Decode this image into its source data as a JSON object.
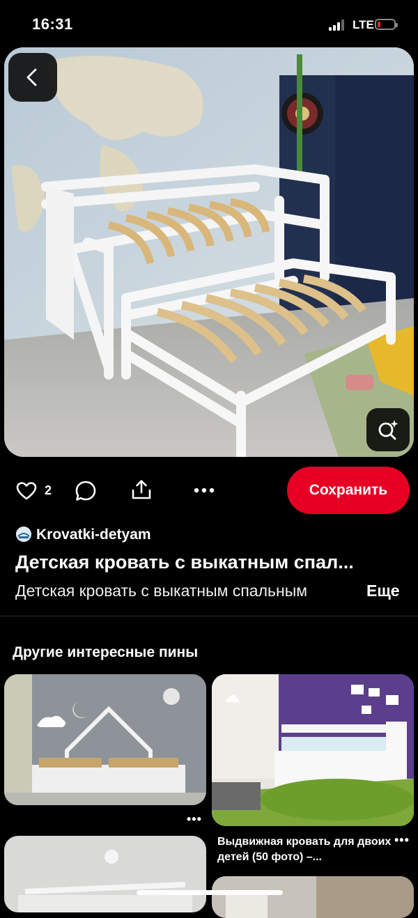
{
  "status_bar": {
    "time": "16:31",
    "network": "LTE"
  },
  "pin": {
    "like_count": "2",
    "save_label": "Сохранить",
    "author": "Krovatki-detyam",
    "title": "Детская кровать с выкатным спал...",
    "description": "Детская кровать с выкатным спальным",
    "more_label": "Еще"
  },
  "related": {
    "section_title": "Другие интересные пины",
    "cards": [
      {
        "title": ""
      },
      {
        "title": "Выдвижная кровать для двоих детей (50 фото) –..."
      }
    ]
  },
  "icons": {
    "back": "chevron-left-icon",
    "lens": "visual-search-icon",
    "like": "heart-icon",
    "comment": "comment-icon",
    "share": "share-icon",
    "more": "more-horizontal-icon"
  },
  "colors": {
    "accent": "#e60023",
    "background": "#000000",
    "battery_low": "#e0262e"
  }
}
